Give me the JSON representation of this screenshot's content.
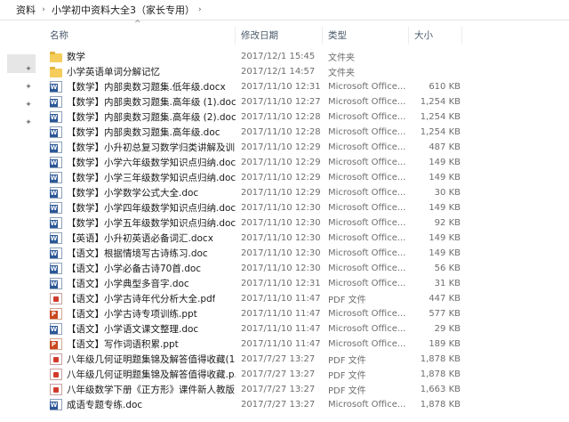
{
  "breadcrumb": {
    "items": [
      "资料",
      "小学初中资料大全3（家长专用）"
    ]
  },
  "columns": {
    "name": "名称",
    "date": "修改日期",
    "type": "类型",
    "size": "大小"
  },
  "files": [
    {
      "name": "数学",
      "date": "2017/12/1 15:45",
      "type": "文件夹",
      "size": "",
      "icon": "folder-icon"
    },
    {
      "name": "小学英语单词分解记忆",
      "date": "2017/12/1 14:57",
      "type": "文件夹",
      "size": "",
      "icon": "folder-icon"
    },
    {
      "name": "【数学】内部奥数习题集.低年级.docx",
      "date": "2017/11/10 12:31",
      "type": "Microsoft Office...",
      "size": "610 KB",
      "icon": "word-doc-icon"
    },
    {
      "name": "【数学】内部奥数习题集.高年级 (1).doc",
      "date": "2017/11/10 12:27",
      "type": "Microsoft Office...",
      "size": "1,254 KB",
      "icon": "word-doc-icon"
    },
    {
      "name": "【数学】内部奥数习题集.高年级 (2).doc",
      "date": "2017/11/10 12:28",
      "type": "Microsoft Office...",
      "size": "1,254 KB",
      "icon": "word-doc-icon"
    },
    {
      "name": "【数学】内部奥数习题集.高年级.doc",
      "date": "2017/11/10 12:28",
      "type": "Microsoft Office...",
      "size": "1,254 KB",
      "icon": "word-doc-icon"
    },
    {
      "name": "【数学】小升初总复习数学归类讲解及训...",
      "date": "2017/11/10 12:29",
      "type": "Microsoft Office...",
      "size": "487 KB",
      "icon": "word-doc-icon"
    },
    {
      "name": "【数学】小学六年级数学知识点归纳.doc",
      "date": "2017/11/10 12:29",
      "type": "Microsoft Office...",
      "size": "149 KB",
      "icon": "word-doc-icon"
    },
    {
      "name": "【数学】小学三年级数学知识点归纳.doc",
      "date": "2017/11/10 12:29",
      "type": "Microsoft Office...",
      "size": "149 KB",
      "icon": "word-doc-icon"
    },
    {
      "name": "【数学】小学数学公式大全.doc",
      "date": "2017/11/10 12:29",
      "type": "Microsoft Office...",
      "size": "30 KB",
      "icon": "word-doc-icon"
    },
    {
      "name": "【数学】小学四年级数学知识点归纳.doc",
      "date": "2017/11/10 12:30",
      "type": "Microsoft Office...",
      "size": "149 KB",
      "icon": "word-doc-icon"
    },
    {
      "name": "【数学】小学五年级数学知识点归纳.doc",
      "date": "2017/11/10 12:30",
      "type": "Microsoft Office...",
      "size": "92 KB",
      "icon": "word-doc-icon"
    },
    {
      "name": "【英语】小升初英语必备词汇.docx",
      "date": "2017/11/10 12:30",
      "type": "Microsoft Office...",
      "size": "149 KB",
      "icon": "word-doc-icon"
    },
    {
      "name": "【语文】根据情境写古诗练习.doc",
      "date": "2017/11/10 12:30",
      "type": "Microsoft Office...",
      "size": "149 KB",
      "icon": "word-doc-icon"
    },
    {
      "name": "【语文】小学必备古诗70首.doc",
      "date": "2017/11/10 12:30",
      "type": "Microsoft Office...",
      "size": "56 KB",
      "icon": "word-doc-icon"
    },
    {
      "name": "【语文】小学典型多音字.doc",
      "date": "2017/11/10 12:31",
      "type": "Microsoft Office...",
      "size": "31 KB",
      "icon": "word-doc-icon"
    },
    {
      "name": "【语文】小学古诗年代分析大全.pdf",
      "date": "2017/11/10 11:47",
      "type": "PDF 文件",
      "size": "447 KB",
      "icon": "pdf-icon"
    },
    {
      "name": "【语文】小学古诗专项训练.ppt",
      "date": "2017/11/10 11:47",
      "type": "Microsoft Office...",
      "size": "577 KB",
      "icon": "ppt-icon"
    },
    {
      "name": "【语文】小学语文课文整理.doc",
      "date": "2017/11/10 11:47",
      "type": "Microsoft Office...",
      "size": "29 KB",
      "icon": "word-doc-icon"
    },
    {
      "name": "【语文】写作词语积累.ppt",
      "date": "2017/11/10 11:47",
      "type": "Microsoft Office...",
      "size": "189 KB",
      "icon": "ppt-icon"
    },
    {
      "name": "八年级几何证明题集锦及解答值得收藏(1...",
      "date": "2017/7/27 13:27",
      "type": "PDF 文件",
      "size": "1,878 KB",
      "icon": "pdf-icon"
    },
    {
      "name": "八年级几何证明题集锦及解答值得收藏.p...",
      "date": "2017/7/27 13:27",
      "type": "PDF 文件",
      "size": "1,878 KB",
      "icon": "pdf-icon"
    },
    {
      "name": "八年级数学下册《正方形》课件新人教版...",
      "date": "2017/7/27 13:27",
      "type": "PDF 文件",
      "size": "1,663 KB",
      "icon": "pdf-icon"
    },
    {
      "name": "成语专题专练.doc",
      "date": "2017/7/27 13:27",
      "type": "Microsoft Office...",
      "size": "1,878 KB",
      "icon": "word-doc-icon"
    }
  ]
}
